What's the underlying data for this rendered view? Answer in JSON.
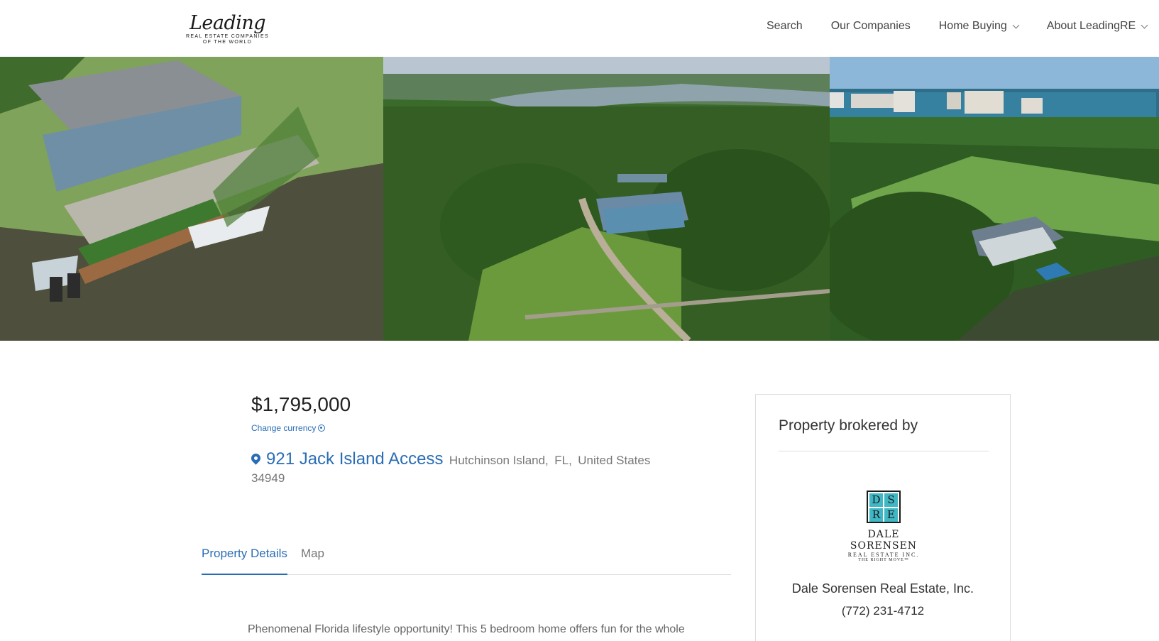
{
  "header": {
    "logo": {
      "script": "Leading",
      "line1": "REAL ESTATE COMPANIES",
      "line2": "OF THE WORLD"
    },
    "nav": [
      {
        "label": "Search",
        "dropdown": false
      },
      {
        "label": "Our Companies",
        "dropdown": false
      },
      {
        "label": "Home Buying",
        "dropdown": true
      },
      {
        "label": "About LeadingRE",
        "dropdown": true
      }
    ]
  },
  "listing": {
    "price": "$1,795,000",
    "change_currency": "Change currency",
    "street": "921 Jack Island Access",
    "city": "Hutchinson Island,",
    "state": "FL,",
    "country": "United States",
    "zip": "34949",
    "tabs": [
      {
        "label": "Property Details",
        "active": true
      },
      {
        "label": "Map",
        "active": false
      }
    ],
    "description": "Phenomenal Florida lifestyle opportunity! This 5 bedroom home offers fun for the whole"
  },
  "broker": {
    "title": "Property brokered by",
    "logo_letters": [
      "D",
      "S",
      "R",
      "E"
    ],
    "logo_name": "DALE SORENSEN",
    "logo_sub": "REAL ESTATE INC.",
    "logo_tagline": "THE RIGHT MOVE™",
    "name": "Dale Sorensen Real Estate, Inc.",
    "phone": "(772) 231-4712"
  },
  "colors": {
    "link": "#2a6db5",
    "logo_teal": "#3fb7c4"
  }
}
